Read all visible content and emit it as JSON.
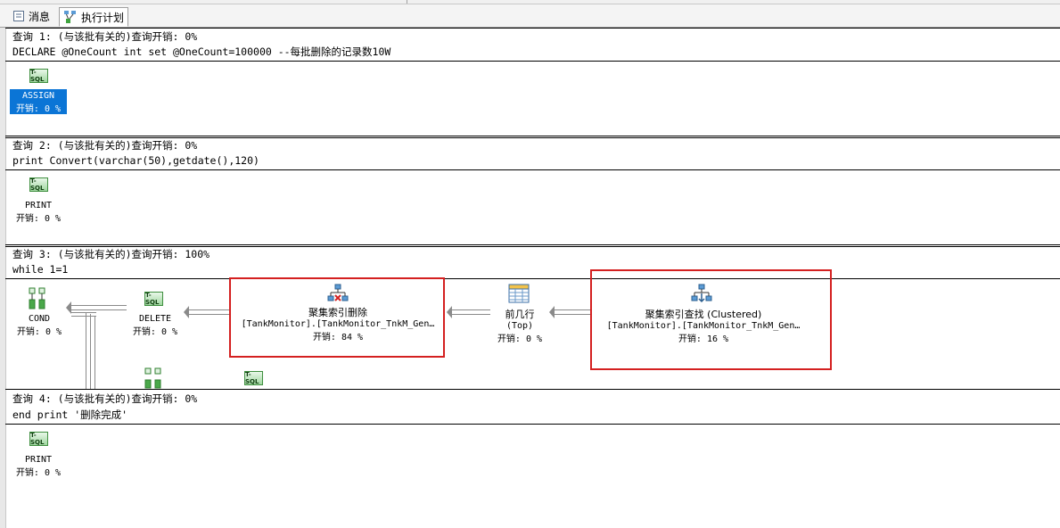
{
  "tabs": [
    {
      "label": "消息",
      "icon": "message-icon"
    },
    {
      "label": "执行计划",
      "icon": "execution-plan-icon",
      "active": true
    }
  ],
  "queries": [
    {
      "header": "查询 1: (与该批有关的)查询开销: 0%",
      "sql": "DECLARE @OneCount int set @OneCount=100000 --每批删除的记录数10W",
      "nodes": [
        {
          "icon": "T-SQL",
          "name": "ASSIGN",
          "cost": "开销: 0 %",
          "selected": true
        }
      ]
    },
    {
      "header": "查询 2: (与该批有关的)查询开销: 0%",
      "sql": "print Convert(varchar(50),getdate(),120)",
      "nodes": [
        {
          "icon": "T-SQL",
          "name": "PRINT",
          "cost": "开销: 0 %"
        }
      ]
    },
    {
      "header": "查询 3: (与该批有关的)查询开销: 100%",
      "sql": "while 1=1",
      "nodes": [
        {
          "name": "COND",
          "cost": "开销: 0 %"
        },
        {
          "icon": "T-SQL",
          "name": "DELETE",
          "cost": "开销: 0 %"
        },
        {
          "name": "聚集索引删除",
          "object": "[TankMonitor].[TankMonitor_TnkM_Gen…",
          "cost": "开销: 84 %"
        },
        {
          "name": "前几行",
          "subname": "(Top)",
          "cost": "开销: 0 %"
        },
        {
          "name": "聚集索引查找 (Clustered)",
          "object": "[TankMonitor].[TankMonitor_TnkM_Gen…",
          "cost": "开销: 16 %"
        }
      ],
      "partial_icon": "T-SQL"
    },
    {
      "header": "查询 4: (与该批有关的)查询开销: 0%",
      "sql": "end print '删除完成'",
      "nodes": [
        {
          "icon": "T-SQL",
          "name": "PRINT",
          "cost": "开销: 0 %"
        }
      ]
    }
  ],
  "colors": {
    "selection": "#0b75d6",
    "highlight_box": "#d42020",
    "tsql_icon": "#9fd79f"
  }
}
